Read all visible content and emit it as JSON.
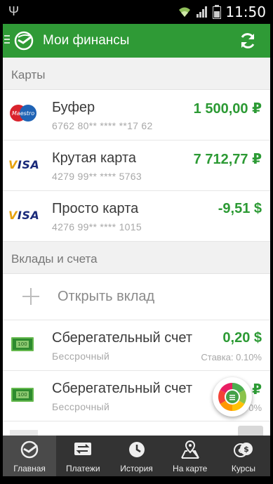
{
  "status_bar": {
    "time": "11:50"
  },
  "app_bar": {
    "title": "Мои финансы"
  },
  "sections": {
    "cards_header": "Карты",
    "deposits_header": "Вклады и счета"
  },
  "cards": [
    {
      "brand": "Maestro",
      "name": "Буфер",
      "number": "6762 80** **** **17 62",
      "amount": "1 500,00 ₽"
    },
    {
      "brand": "VISA",
      "name": "Крутая карта",
      "number": "4279 99** **** 5763",
      "amount": "7 712,77 ₽"
    },
    {
      "brand": "VISA",
      "name": "Просто карта",
      "number": "4276 99** **** 1015",
      "amount": "-9,51 $"
    }
  ],
  "open_deposit": {
    "label": "Открыть вклад"
  },
  "accounts": [
    {
      "icon_text": "100",
      "name": "Сберегательный счет",
      "term": "Бессрочный",
      "amount": "0,20 $",
      "rate": "Ставка: 0.10%"
    },
    {
      "icon_text": "100",
      "name": "Сберегательный счет",
      "term": "Бессрочный",
      "amount": "₽",
      "rate": "Ста      0%"
    }
  ],
  "bottom_nav": [
    {
      "label": "Главная",
      "icon": "sber-logo-icon"
    },
    {
      "label": "Платежи",
      "icon": "transfer-icon"
    },
    {
      "label": "История",
      "icon": "clock-icon"
    },
    {
      "label": "На карте",
      "icon": "map-pin-icon"
    },
    {
      "label": "Курсы",
      "icon": "currency-icon"
    }
  ],
  "colors": {
    "brand_green": "#2f9a36",
    "amount_green": "#2c9a34",
    "nav_bg": "#333333"
  }
}
